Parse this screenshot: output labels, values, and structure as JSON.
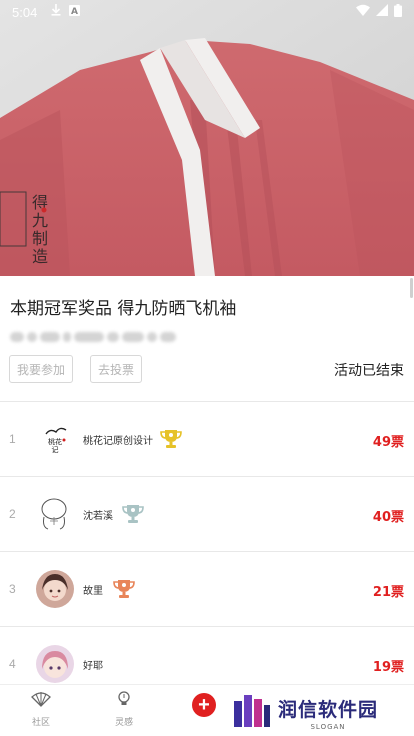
{
  "status_bar": {
    "time": "5:04",
    "icons_left": [
      "download-icon",
      "letter-a-icon"
    ],
    "icons_right": [
      "wifi-icon",
      "signal-icon",
      "battery-icon"
    ]
  },
  "hero": {
    "image": "red-hanfu-robe-collar-photo",
    "logo_text": "得九制造"
  },
  "activity": {
    "title": "本期冠军奖品 得九防晒飞机袖",
    "join_label": "我要参加",
    "vote_label": "去投票",
    "status_label": "活动已结束"
  },
  "ranking": [
    {
      "rank": "1",
      "name": "桃花记原创设计",
      "votes": "49票",
      "trophy": "gold"
    },
    {
      "rank": "2",
      "name": "沈若溪",
      "votes": "40票",
      "trophy": "silver"
    },
    {
      "rank": "3",
      "name": "故里",
      "votes": "21票",
      "trophy": "bronze"
    },
    {
      "rank": "4",
      "name": "好耶",
      "votes": "19票",
      "trophy": ""
    }
  ],
  "tabbar": {
    "community_label": "社区",
    "inspire_label": "灵感",
    "plus_symbol": "+"
  },
  "watermark": {
    "text": "润信软件园",
    "slogan": "SLOGAN"
  },
  "colors": {
    "accent_red": "#e02020",
    "gold": "#e6c229",
    "silver": "#a9c3c4",
    "bronze": "#e8855a"
  }
}
